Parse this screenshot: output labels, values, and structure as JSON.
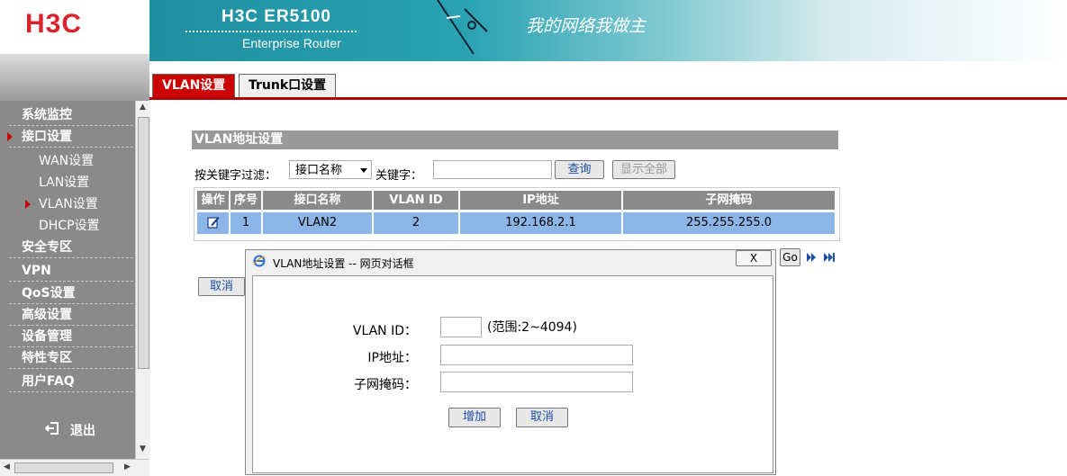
{
  "header": {
    "logo": "H3C",
    "product": "H3C ER5100",
    "subtitle": "Enterprise Router",
    "slogan": "我的网络我做主"
  },
  "tabs": [
    {
      "label": "VLAN设置",
      "active": true
    },
    {
      "label": "Trunk口设置",
      "active": false
    }
  ],
  "sidebar": {
    "items": [
      {
        "label": "系统监控"
      },
      {
        "label": "接口设置"
      },
      {
        "label": "WAN设置"
      },
      {
        "label": "LAN设置"
      },
      {
        "label": "VLAN设置"
      },
      {
        "label": "DHCP设置"
      },
      {
        "label": "安全专区"
      },
      {
        "label": "VPN"
      },
      {
        "label": "QoS设置"
      },
      {
        "label": "高级设置"
      },
      {
        "label": "设备管理"
      },
      {
        "label": "特性专区"
      },
      {
        "label": "用户FAQ"
      }
    ],
    "logout": "退出"
  },
  "main": {
    "section_title": "VLAN地址设置",
    "filter_label": "按关键字过滤：",
    "filter_select": "接口名称",
    "keyword_label": "关键字：",
    "keyword_value": "",
    "search_button": "查询",
    "show_all_button": "显示全部",
    "cancel_button": "取消",
    "go_button": "Go"
  },
  "table": {
    "headers": [
      "操作",
      "序号",
      "接口名称",
      "VLAN ID",
      "IP地址",
      "子网掩码"
    ],
    "rows": [
      {
        "index": "1",
        "interface": "VLAN2",
        "vlan_id": "2",
        "ip": "192.168.2.1",
        "mask": "255.255.255.0"
      }
    ]
  },
  "dialog": {
    "title": "VLAN地址设置 -- 网页对话框",
    "close": "X",
    "vlan_id_label": "VLAN ID：",
    "vlan_id_value": "",
    "range_hint": "(范围:2~4094)",
    "ip_label": "IP地址：",
    "ip_value": "",
    "mask_label": "子网掩码：",
    "mask_value": "",
    "add_button": "增加",
    "cancel_button": "取消"
  },
  "colors": {
    "accent_red": "#cc0000",
    "sidebar_gray": "#8a8a8a",
    "row_highlight": "#8db6e8",
    "banner_teal": "#2aa3b3"
  }
}
